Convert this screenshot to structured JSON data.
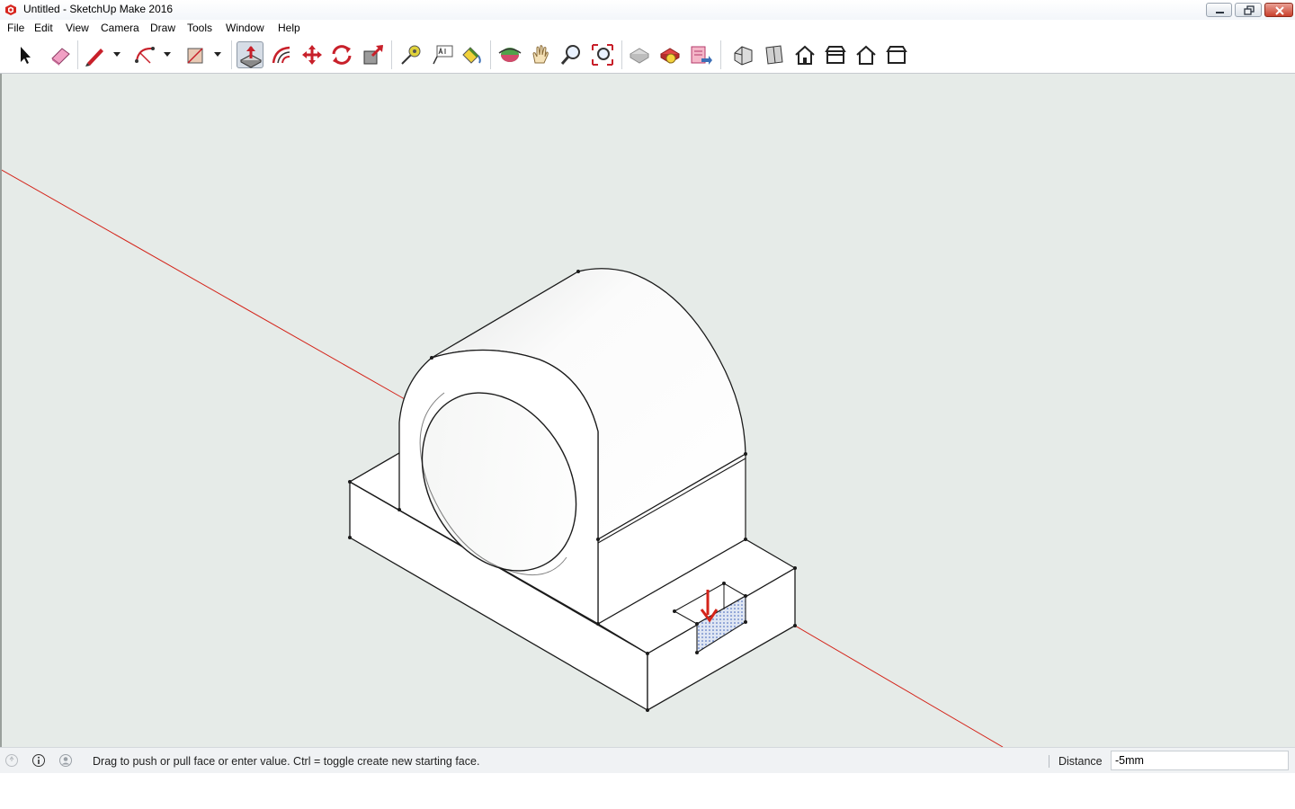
{
  "window": {
    "title": "Untitled - SketchUp Make 2016",
    "controls": [
      "minimize",
      "maximize",
      "close"
    ]
  },
  "menu": [
    "File",
    "Edit",
    "View",
    "Camera",
    "Draw",
    "Tools",
    "Window",
    "Help"
  ],
  "toolbar": {
    "tools": [
      {
        "name": "select-icon",
        "label": "Select"
      },
      {
        "name": "eraser-icon",
        "label": "Eraser"
      },
      {
        "name": "pencil-line-icon",
        "label": "Line"
      },
      {
        "name": "arc-icon",
        "label": "Arc"
      },
      {
        "name": "rectangle-icon",
        "label": "Rectangle"
      },
      {
        "name": "push-pull-icon",
        "label": "Push/Pull",
        "active": true
      },
      {
        "name": "offset-icon",
        "label": "Offset"
      },
      {
        "name": "move-icon",
        "label": "Move"
      },
      {
        "name": "rotate-icon",
        "label": "Rotate"
      },
      {
        "name": "scale-icon",
        "label": "Scale"
      },
      {
        "name": "tape-measure-icon",
        "label": "Tape Measure"
      },
      {
        "name": "text-icon",
        "label": "Text"
      },
      {
        "name": "paint-bucket-icon",
        "label": "Paint Bucket"
      },
      {
        "name": "orbit-icon",
        "label": "Orbit"
      },
      {
        "name": "pan-icon",
        "label": "Pan"
      },
      {
        "name": "zoom-icon",
        "label": "Zoom"
      },
      {
        "name": "zoom-extents-icon",
        "label": "Zoom Extents"
      },
      {
        "name": "warehouse-icon",
        "label": "3D Warehouse"
      },
      {
        "name": "extension-warehouse-icon",
        "label": "Extension Warehouse"
      },
      {
        "name": "layout-send-icon",
        "label": "Send to LayOut"
      },
      {
        "name": "iso-view-icon",
        "label": "Iso"
      },
      {
        "name": "top-view-icon",
        "label": "Top"
      },
      {
        "name": "front-view-icon",
        "label": "Front"
      },
      {
        "name": "right-view-icon",
        "label": "Right"
      },
      {
        "name": "back-view-icon",
        "label": "Back"
      },
      {
        "name": "left-view-icon",
        "label": "Left"
      }
    ]
  },
  "status": {
    "message": "Drag to push or pull face or enter value.  Ctrl = toggle create new starting face.",
    "measure_label": "Distance",
    "measure_value": "-5mm"
  },
  "colors": {
    "viewport_bg": "#e6ebe8",
    "red_axis": "#d4241a",
    "model_face": "#ffffff",
    "edge": "#1a1a1a",
    "active_tool_bg": "#d6dde6"
  }
}
